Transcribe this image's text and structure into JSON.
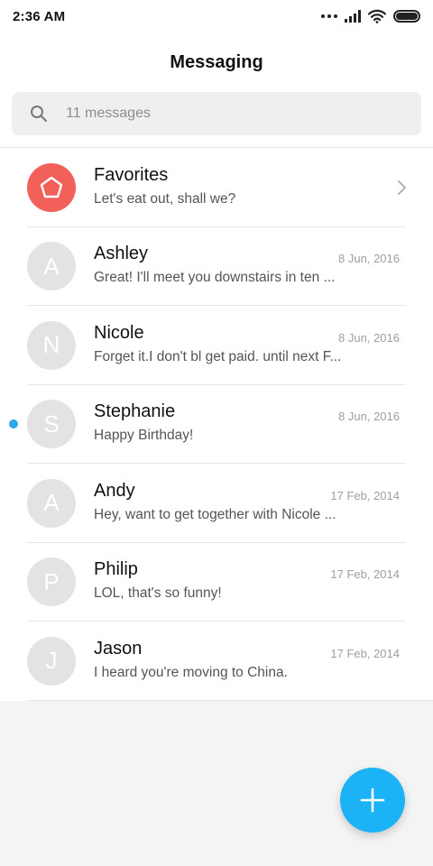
{
  "status_bar": {
    "time": "2:36 AM"
  },
  "header": {
    "title": "Messaging"
  },
  "search": {
    "placeholder": "11 messages"
  },
  "favorites": {
    "name": "Favorites",
    "preview": "Let's eat out, shall we?"
  },
  "conversations": [
    {
      "initial": "A",
      "name": "Ashley",
      "preview": "Great! I'll meet you downstairs in ten ...",
      "date": "8 Jun, 2016",
      "unread": false
    },
    {
      "initial": "N",
      "name": "Nicole",
      "preview": "Forget it.I don't bl get paid. until next F...",
      "date": "8 Jun, 2016",
      "unread": false
    },
    {
      "initial": "S",
      "name": "Stephanie",
      "preview": "Happy Birthday!",
      "date": "8 Jun, 2016",
      "unread": true
    },
    {
      "initial": "A",
      "name": "Andy",
      "preview": "Hey, want to get together with Nicole ...",
      "date": "17 Feb, 2014",
      "unread": false
    },
    {
      "initial": "P",
      "name": "Philip",
      "preview": "LOL, that's so funny!",
      "date": "17 Feb, 2014",
      "unread": false
    },
    {
      "initial": "J",
      "name": "Jason",
      "preview": "I heard you're moving to China.",
      "date": "17 Feb, 2014",
      "unread": false
    }
  ],
  "colors": {
    "accent": "#1cb3f6",
    "favorites": "#f2605a",
    "unread_dot": "#2ea7f0"
  },
  "icons": {
    "search": "search-icon",
    "favorites": "pentagon-icon",
    "chevron": "chevron-right-icon",
    "compose": "plus-icon"
  }
}
